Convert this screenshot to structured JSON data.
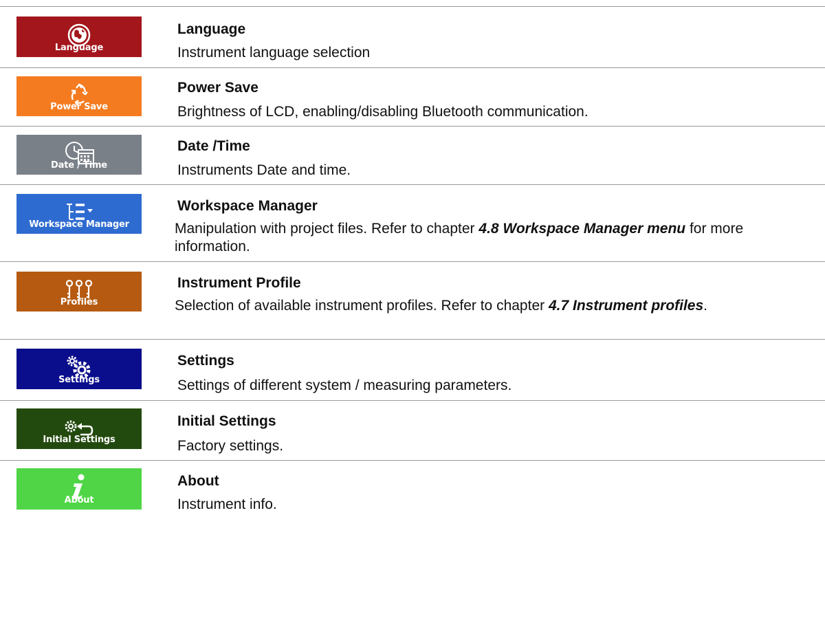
{
  "rows": [
    {
      "tile_label": "Language",
      "tile_color": "#a3161c",
      "icon": "globe-icon",
      "title": "Language",
      "desc": "Instrument language selection"
    },
    {
      "tile_label": "Power Save",
      "tile_color": "#f47b20",
      "icon": "recycle-icon",
      "title": "Power Save",
      "desc": "Brightness of LCD, enabling/disabling Bluetooth communication."
    },
    {
      "tile_label": "Date / Time",
      "tile_color": "#7a8088",
      "icon": "clock-calendar-icon",
      "title": "Date /Time",
      "desc": "Instruments Date and time."
    },
    {
      "tile_label": "Workspace Manager",
      "tile_color": "#2e6bd1",
      "icon": "tree-list-icon",
      "title": "Workspace Manager",
      "desc_parts": [
        "Manipulation with project files. Refer to chapter ",
        "4.8 Workspace Manager menu",
        " for more information."
      ]
    },
    {
      "tile_label": "Profiles",
      "tile_color": "#b55a10",
      "icon": "keys-icon",
      "title": "Instrument Profile",
      "desc_parts": [
        "Selection of available instrument profiles. Refer to chapter ",
        "4.7 Instrument profiles",
        "."
      ]
    },
    {
      "tile_label": "Settings",
      "tile_color": "#0b0e8c",
      "icon": "gears-icon",
      "title": "Settings",
      "desc": "Settings of different system / measuring parameters."
    },
    {
      "tile_label": "Initial Settings",
      "tile_color": "#234a0e",
      "icon": "gear-return-icon",
      "title": "Initial Settings",
      "desc": "Factory settings."
    },
    {
      "tile_label": "About",
      "tile_color": "#4fd545",
      "icon": "info-icon",
      "title": "About",
      "desc": "Instrument info."
    }
  ]
}
